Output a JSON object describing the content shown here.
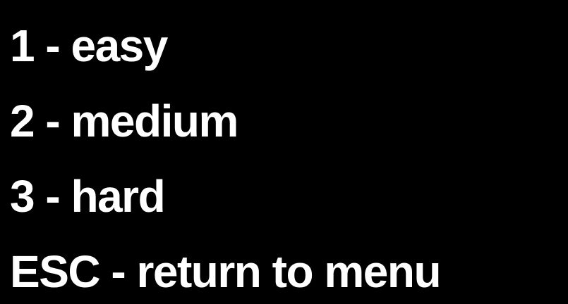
{
  "difficulty_menu": {
    "items": [
      {
        "key": "1",
        "label": "1 - easy"
      },
      {
        "key": "2",
        "label": "2 - medium"
      },
      {
        "key": "3",
        "label": "3 - hard"
      },
      {
        "key": "ESC",
        "label": "ESC - return to menu"
      }
    ]
  },
  "colors": {
    "background": "#000000",
    "text": "#ffffff"
  }
}
